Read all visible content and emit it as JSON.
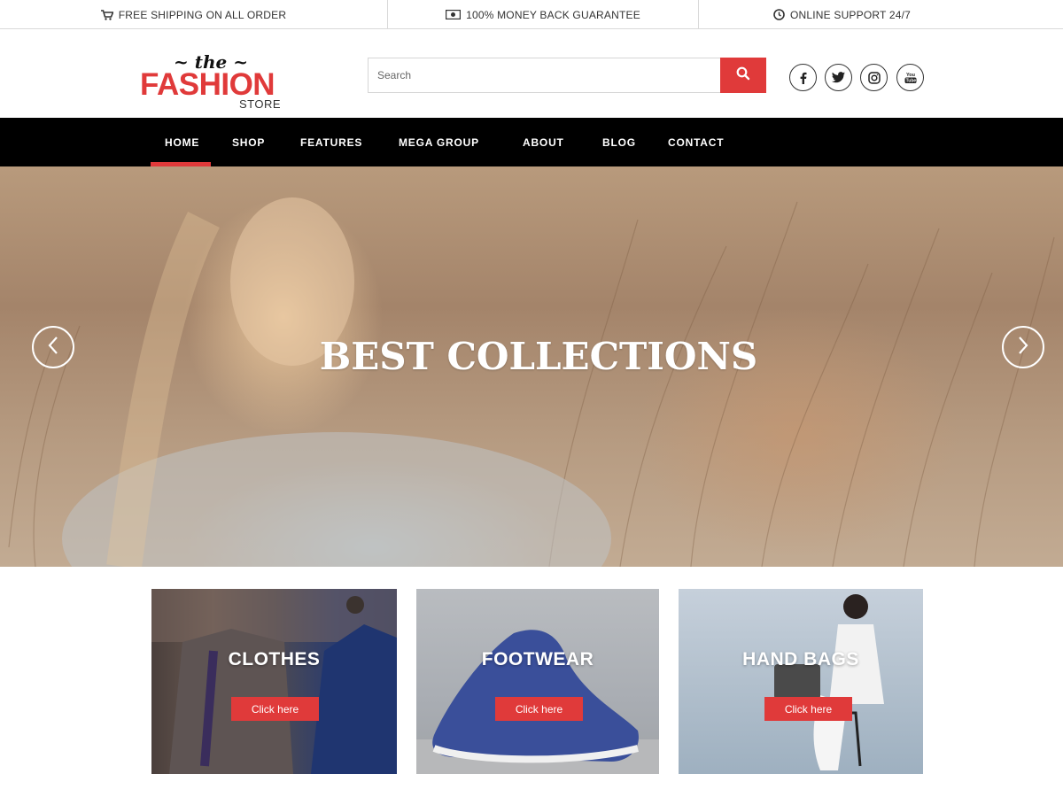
{
  "topbar": {
    "shipping": "FREE SHIPPING ON ALL ORDER",
    "guarantee": "100% MONEY BACK GUARANTEE",
    "support": "ONLINE SUPPORT 24/7",
    "icons": [
      "cart-icon",
      "money-icon",
      "clock-icon"
    ]
  },
  "logo": {
    "the": "~ the ~",
    "fashion": "FASHION",
    "store": "STORE"
  },
  "search": {
    "placeholder": "Search",
    "button_icon": "search-icon"
  },
  "social": [
    "facebook-icon",
    "twitter-icon",
    "instagram-icon",
    "youtube-icon"
  ],
  "nav": {
    "items": [
      {
        "label": "HOME",
        "active": true
      },
      {
        "label": "SHOP"
      },
      {
        "label": "FEATURES"
      },
      {
        "label": "MEGA GROUP"
      },
      {
        "label": "ABOUT"
      },
      {
        "label": "BLOG"
      },
      {
        "label": "CONTACT"
      }
    ]
  },
  "hero": {
    "headline": "BEST COLLECTIONS",
    "prev_icon": "chevron-left-icon",
    "next_icon": "chevron-right-icon"
  },
  "categories": [
    {
      "title": "CLOTHES",
      "cta": "Click here"
    },
    {
      "title": "FOOTWEAR",
      "cta": "Click here"
    },
    {
      "title": "HAND BAGS",
      "cta": "Click here"
    }
  ],
  "colors": {
    "accent": "#e03a3a",
    "nav_bg": "#000000",
    "text": "#333333"
  }
}
